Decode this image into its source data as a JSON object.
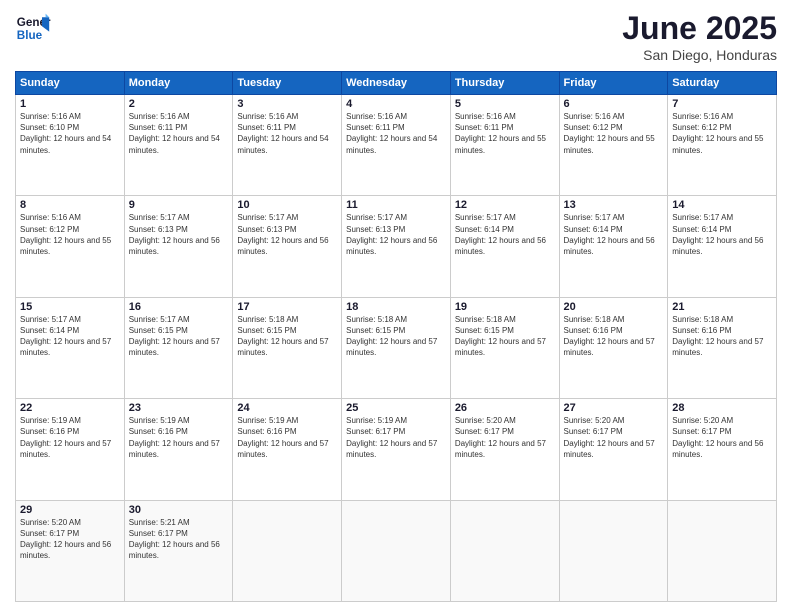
{
  "header": {
    "logo_line1": "General",
    "logo_line2": "Blue",
    "month": "June 2025",
    "location": "San Diego, Honduras"
  },
  "weekdays": [
    "Sunday",
    "Monday",
    "Tuesday",
    "Wednesday",
    "Thursday",
    "Friday",
    "Saturday"
  ],
  "weeks": [
    [
      {
        "day": "1",
        "sunrise": "5:16 AM",
        "sunset": "6:10 PM",
        "daylight": "12 hours and 54 minutes."
      },
      {
        "day": "2",
        "sunrise": "5:16 AM",
        "sunset": "6:11 PM",
        "daylight": "12 hours and 54 minutes."
      },
      {
        "day": "3",
        "sunrise": "5:16 AM",
        "sunset": "6:11 PM",
        "daylight": "12 hours and 54 minutes."
      },
      {
        "day": "4",
        "sunrise": "5:16 AM",
        "sunset": "6:11 PM",
        "daylight": "12 hours and 54 minutes."
      },
      {
        "day": "5",
        "sunrise": "5:16 AM",
        "sunset": "6:11 PM",
        "daylight": "12 hours and 55 minutes."
      },
      {
        "day": "6",
        "sunrise": "5:16 AM",
        "sunset": "6:12 PM",
        "daylight": "12 hours and 55 minutes."
      },
      {
        "day": "7",
        "sunrise": "5:16 AM",
        "sunset": "6:12 PM",
        "daylight": "12 hours and 55 minutes."
      }
    ],
    [
      {
        "day": "8",
        "sunrise": "5:16 AM",
        "sunset": "6:12 PM",
        "daylight": "12 hours and 55 minutes."
      },
      {
        "day": "9",
        "sunrise": "5:17 AM",
        "sunset": "6:13 PM",
        "daylight": "12 hours and 56 minutes."
      },
      {
        "day": "10",
        "sunrise": "5:17 AM",
        "sunset": "6:13 PM",
        "daylight": "12 hours and 56 minutes."
      },
      {
        "day": "11",
        "sunrise": "5:17 AM",
        "sunset": "6:13 PM",
        "daylight": "12 hours and 56 minutes."
      },
      {
        "day": "12",
        "sunrise": "5:17 AM",
        "sunset": "6:14 PM",
        "daylight": "12 hours and 56 minutes."
      },
      {
        "day": "13",
        "sunrise": "5:17 AM",
        "sunset": "6:14 PM",
        "daylight": "12 hours and 56 minutes."
      },
      {
        "day": "14",
        "sunrise": "5:17 AM",
        "sunset": "6:14 PM",
        "daylight": "12 hours and 56 minutes."
      }
    ],
    [
      {
        "day": "15",
        "sunrise": "5:17 AM",
        "sunset": "6:14 PM",
        "daylight": "12 hours and 57 minutes."
      },
      {
        "day": "16",
        "sunrise": "5:17 AM",
        "sunset": "6:15 PM",
        "daylight": "12 hours and 57 minutes."
      },
      {
        "day": "17",
        "sunrise": "5:18 AM",
        "sunset": "6:15 PM",
        "daylight": "12 hours and 57 minutes."
      },
      {
        "day": "18",
        "sunrise": "5:18 AM",
        "sunset": "6:15 PM",
        "daylight": "12 hours and 57 minutes."
      },
      {
        "day": "19",
        "sunrise": "5:18 AM",
        "sunset": "6:15 PM",
        "daylight": "12 hours and 57 minutes."
      },
      {
        "day": "20",
        "sunrise": "5:18 AM",
        "sunset": "6:16 PM",
        "daylight": "12 hours and 57 minutes."
      },
      {
        "day": "21",
        "sunrise": "5:18 AM",
        "sunset": "6:16 PM",
        "daylight": "12 hours and 57 minutes."
      }
    ],
    [
      {
        "day": "22",
        "sunrise": "5:19 AM",
        "sunset": "6:16 PM",
        "daylight": "12 hours and 57 minutes."
      },
      {
        "day": "23",
        "sunrise": "5:19 AM",
        "sunset": "6:16 PM",
        "daylight": "12 hours and 57 minutes."
      },
      {
        "day": "24",
        "sunrise": "5:19 AM",
        "sunset": "6:16 PM",
        "daylight": "12 hours and 57 minutes."
      },
      {
        "day": "25",
        "sunrise": "5:19 AM",
        "sunset": "6:17 PM",
        "daylight": "12 hours and 57 minutes."
      },
      {
        "day": "26",
        "sunrise": "5:20 AM",
        "sunset": "6:17 PM",
        "daylight": "12 hours and 57 minutes."
      },
      {
        "day": "27",
        "sunrise": "5:20 AM",
        "sunset": "6:17 PM",
        "daylight": "12 hours and 57 minutes."
      },
      {
        "day": "28",
        "sunrise": "5:20 AM",
        "sunset": "6:17 PM",
        "daylight": "12 hours and 56 minutes."
      }
    ],
    [
      {
        "day": "29",
        "sunrise": "5:20 AM",
        "sunset": "6:17 PM",
        "daylight": "12 hours and 56 minutes."
      },
      {
        "day": "30",
        "sunrise": "5:21 AM",
        "sunset": "6:17 PM",
        "daylight": "12 hours and 56 minutes."
      },
      null,
      null,
      null,
      null,
      null
    ]
  ]
}
